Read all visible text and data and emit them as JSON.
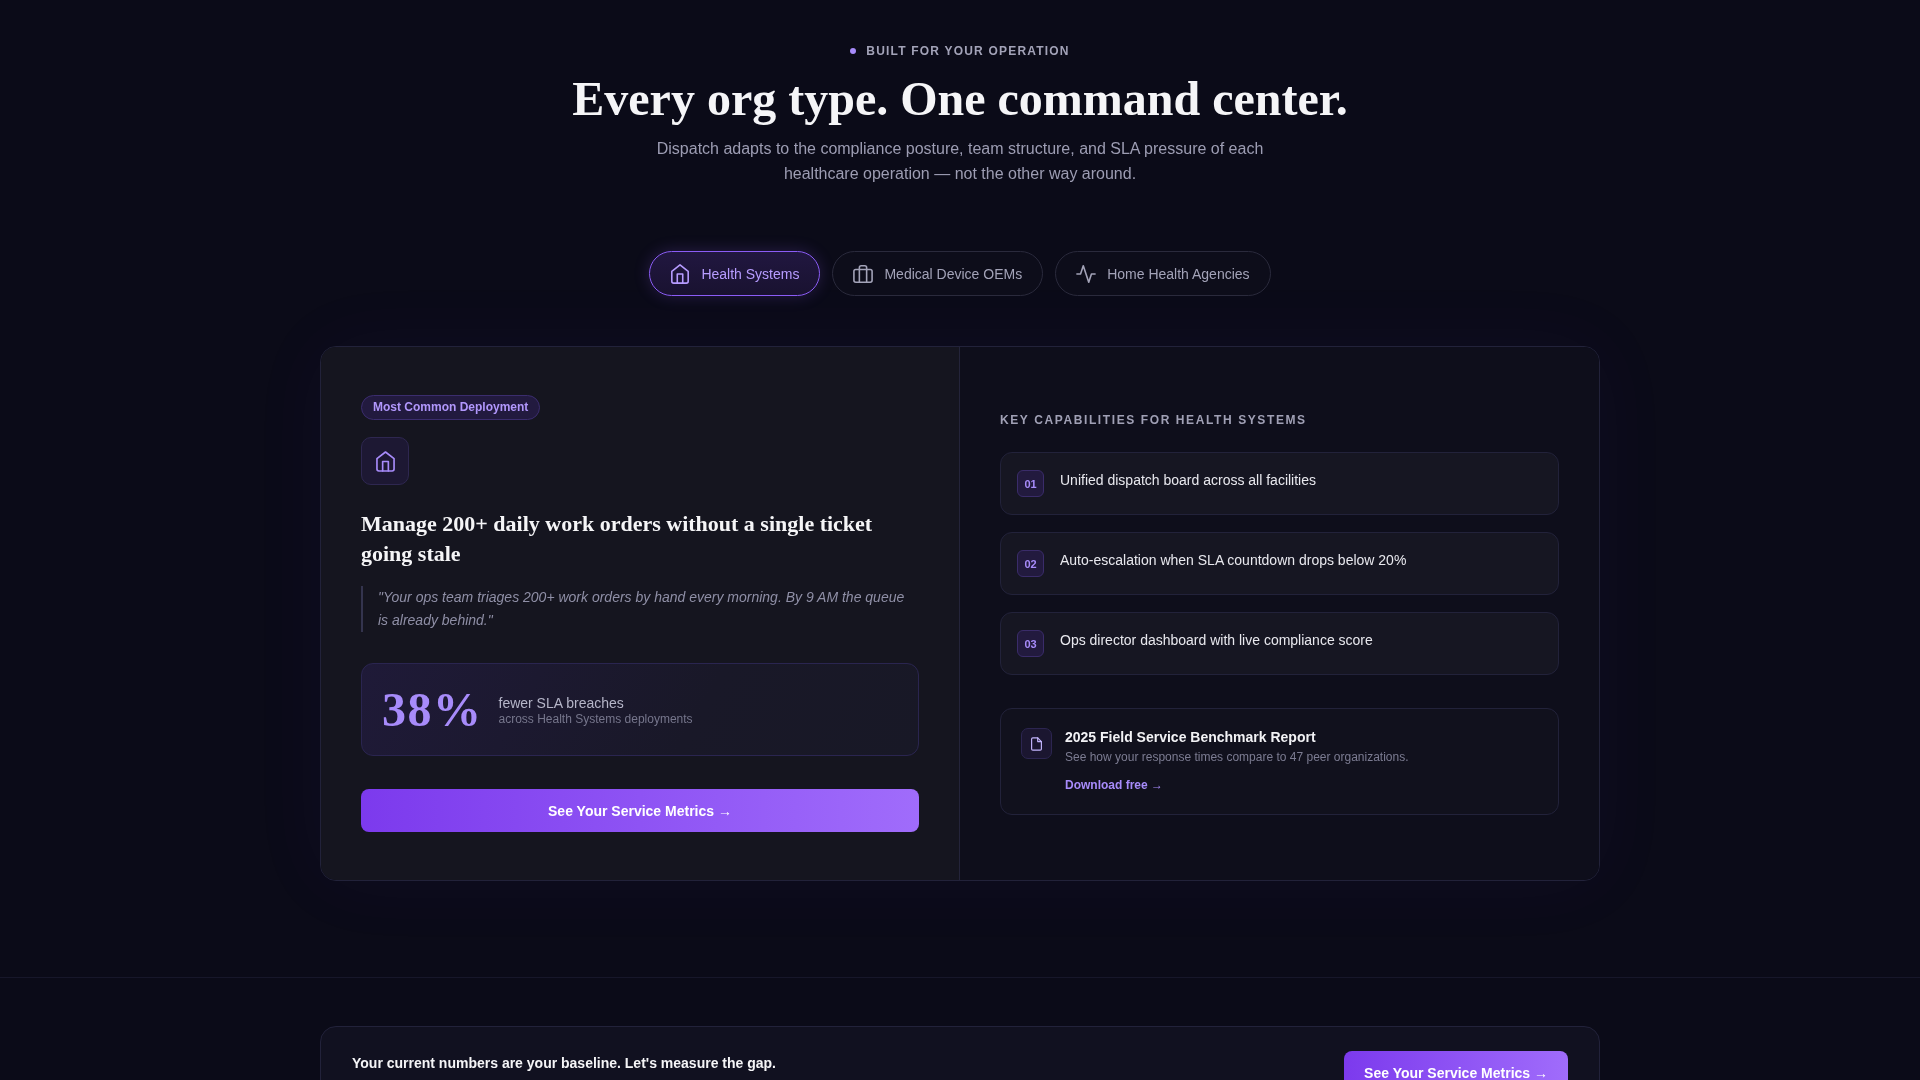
{
  "header": {
    "eyebrow": "BUILT FOR YOUR OPERATION",
    "title": "Every org type. One command center.",
    "subtitle": "Dispatch adapts to the compliance posture, team structure, and SLA pressure of each healthcare operation — not the other way around."
  },
  "tabs": [
    {
      "label": "Health Systems",
      "selected": true
    },
    {
      "label": "Medical Device OEMs",
      "selected": false
    },
    {
      "label": "Home Health Agencies",
      "selected": false
    }
  ],
  "overview": {
    "tag": "Most Common Deployment",
    "heading": "Manage 200+ daily work orders without a single ticket going stale",
    "quote": "\"Your ops team triages 200+ work orders by hand every morning. By 9 AM the queue is already behind.\"",
    "stat": {
      "value": "38%",
      "label": "fewer SLA breaches",
      "note": "across Health Systems deployments"
    },
    "button": "See Your Service Metrics →"
  },
  "capabilities": {
    "title": "KEY CAPABILITIES FOR HEALTH SYSTEMS",
    "items": [
      {
        "number": "01",
        "text": "Unified dispatch board across all facilities"
      },
      {
        "number": "02",
        "text": "Auto-escalation when SLA countdown drops below 20%"
      },
      {
        "number": "03",
        "text": "Ops director dashboard with live compliance score"
      }
    ]
  },
  "report": {
    "title": "2025 Field Service Benchmark Report",
    "description": "See how your response times compare to 47 peer organizations.",
    "link": "Download free →"
  },
  "banner": {
    "text": "Your current numbers are your baseline. Let's measure the gap.",
    "button": "See Your Service Metrics →"
  }
}
